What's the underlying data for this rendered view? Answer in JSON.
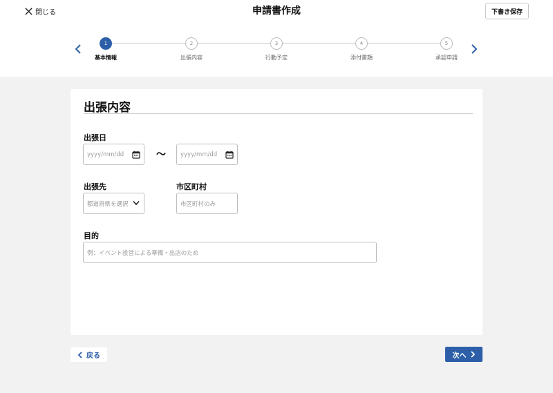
{
  "header": {
    "close_label": "閉じる",
    "title": "申請書作成",
    "draft_save_label": "下書き保存"
  },
  "stepper": {
    "current": 1,
    "steps": [
      {
        "number": "1",
        "label": "基本情報"
      },
      {
        "number": "2",
        "label": "出張内容"
      },
      {
        "number": "3",
        "label": "行動予定"
      },
      {
        "number": "4",
        "label": "添付書類"
      },
      {
        "number": "5",
        "label": "承認申請"
      }
    ]
  },
  "form": {
    "section_title": "出張内容",
    "trip_date": {
      "label": "出張日",
      "start_placeholder": "yyyy/mm/dd",
      "separator": "〜",
      "end_placeholder": "yyyy/mm/dd"
    },
    "destination": {
      "label": "出張先",
      "placeholder": "都道府県を選択"
    },
    "city": {
      "label": "市区町村",
      "placeholder": "市区町村のみ"
    },
    "purpose": {
      "label": "目的",
      "placeholder": "例：イベント設営による準備・出店のため"
    }
  },
  "footer": {
    "back_label": "戻る",
    "next_label": "次へ"
  },
  "colors": {
    "accent": "#2d5fa8",
    "background": "#f2f2f2",
    "card": "#ffffff"
  },
  "icons": [
    "close-icon",
    "chevron-left-icon",
    "chevron-right-icon",
    "calendar-icon",
    "chevron-down-icon"
  ]
}
